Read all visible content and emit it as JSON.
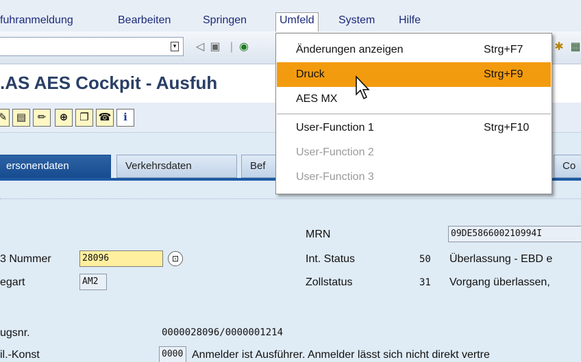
{
  "menubar": {
    "items": [
      {
        "label": "fuhranmeldung",
        "underline": "f"
      },
      {
        "label": "Bearbeiten",
        "underline": "B"
      },
      {
        "label": "Springen",
        "underline": "S"
      },
      {
        "label": "Umfeld",
        "underline": "U"
      },
      {
        "label": "System",
        "underline": "y"
      },
      {
        "label": "Hilfe",
        "underline": "H"
      }
    ]
  },
  "title": ".AS AES Cockpit  - Ausfuh",
  "tabs": [
    {
      "label": "ersonendaten",
      "active": true
    },
    {
      "label": "Verkehrsdaten",
      "active": false
    },
    {
      "label": "Bef",
      "active": false
    },
    {
      "label": "Co",
      "active": false
    }
  ],
  "dropdown": {
    "items": [
      {
        "label": "Änderungen anzeigen",
        "shortcut": "Strg+F7",
        "state": "normal"
      },
      {
        "label": "Druck",
        "shortcut": "Strg+F9",
        "state": "highlighted"
      },
      {
        "label": "AES MX",
        "shortcut": "",
        "state": "normal"
      },
      {
        "label": "User-Function 1",
        "shortcut": "Strg+F10",
        "state": "normal"
      },
      {
        "label": "User-Function 2",
        "shortcut": "",
        "state": "disabled"
      },
      {
        "label": "User-Function 3",
        "shortcut": "",
        "state": "disabled"
      }
    ]
  },
  "form": {
    "mrn_label": "MRN",
    "mrn_value": "09DE586600210994I",
    "nummer_label": "3 Nummer",
    "nummer_value": "28096",
    "int_status_label": "Int. Status",
    "int_status_code": "50",
    "int_status_text": "Überlassung - EBD e",
    "egart_label": "egart",
    "egart_value": "AM2",
    "zollstatus_label": "Zollstatus",
    "zollstatus_code": "31",
    "zollstatus_text": "Vorgang überlassen,",
    "bezugsnr_label": "ugsnr.",
    "bezugsnr_value": "0000028096/0000001214",
    "teilkonst_label": "il.-Konst",
    "teilkonst_code": "0000",
    "teilkonst_text": "Anmelder ist Ausführer. Anmelder lässt sich nicht direkt vertre"
  },
  "colors": {
    "highlight": "#f39b0f",
    "active_tab": "#1e5aa3",
    "background": "#dfebf5"
  }
}
